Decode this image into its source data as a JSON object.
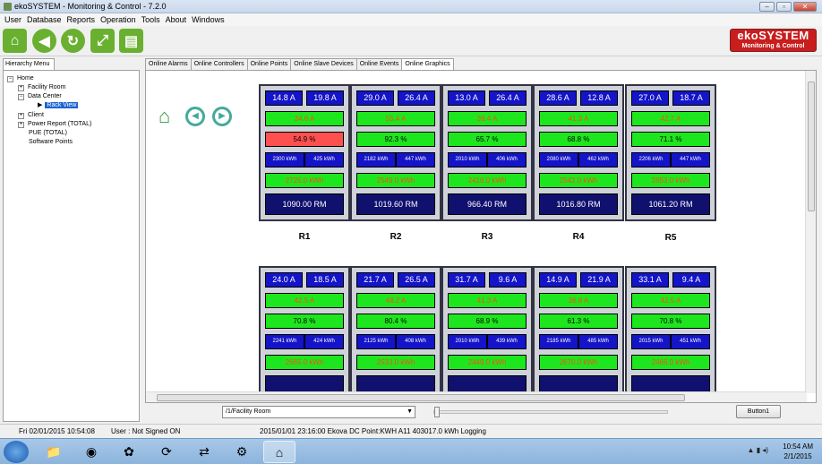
{
  "window": {
    "title": "ekoSYSTEM - Monitoring & Control - 7.2.0"
  },
  "menu": [
    "User",
    "Database",
    "Reports",
    "Operation",
    "Tools",
    "About",
    "Windows"
  ],
  "logo": {
    "line1": "ekoSYSTEM",
    "line2": "Monitoring & Control"
  },
  "left_panel": {
    "tab": "Hierarchy Menu",
    "tree": [
      {
        "label": "Home",
        "sign": "−"
      },
      {
        "label": "Facility Room",
        "sign": "+"
      },
      {
        "label": "Data Center",
        "sign": "−"
      },
      {
        "label": "Rack View",
        "sign": ""
      },
      {
        "label": "Client",
        "sign": "+"
      },
      {
        "label": "Power Report (TOTAL)",
        "sign": "+"
      },
      {
        "label": "PUE (TOTAL)",
        "sign": ""
      },
      {
        "label": "Software Points",
        "sign": ""
      }
    ]
  },
  "tabs": [
    "Online Alarms",
    "Online Controllers",
    "Online Points",
    "Online Slave Devices",
    "Online Events",
    "Online Graphics"
  ],
  "racks_top": [
    {
      "label": "R1",
      "a1": "14.8 A",
      "a2": "19.8 A",
      "load": "34.6 A",
      "pct": "54.9 %",
      "pct_alarm": true,
      "kwh1": "2300 kWh",
      "kwh2": "425 kWh",
      "total_kwh": "2725.0 kWh",
      "rm": "1090.00 RM"
    },
    {
      "label": "R2",
      "a1": "29.0 A",
      "a2": "26.4 A",
      "load": "55.4 A",
      "pct": "92.3 %",
      "pct_alarm": false,
      "kwh1": "2182 kWh",
      "kwh2": "447 kWh",
      "total_kwh": "2549.0 kWh",
      "rm": "1019.60 RM"
    },
    {
      "label": "R3",
      "a1": "13.0 A",
      "a2": "26.4 A",
      "load": "39.4 A",
      "pct": "65.7 %",
      "pct_alarm": false,
      "kwh1": "2010 kWh",
      "kwh2": "406 kWh",
      "total_kwh": "2416.0 kWh",
      "rm": "966.40 RM"
    },
    {
      "label": "R4",
      "a1": "28.6 A",
      "a2": "12.8 A",
      "load": "41.3 A",
      "pct": "68.8 %",
      "pct_alarm": false,
      "kwh1": "2080 kWh",
      "kwh2": "462 kWh",
      "total_kwh": "2542.0 kWh",
      "rm": "1016.80 RM"
    },
    {
      "label": "R5",
      "a1": "27.0 A",
      "a2": "18.7 A",
      "load": "42.7 A",
      "pct": "71.1 %",
      "pct_alarm": false,
      "kwh1": "2206 kWh",
      "kwh2": "447 kWh",
      "total_kwh": "2653.0 kWh",
      "rm": "1061.20 RM"
    }
  ],
  "racks_bottom": [
    {
      "a1": "24.0 A",
      "a2": "18.5 A",
      "load": "42.5 A",
      "pct": "70.8 %",
      "kwh1": "2241 kWh",
      "kwh2": "424 kWh",
      "total_kwh": "2665.0 kWh"
    },
    {
      "a1": "21.7 A",
      "a2": "26.5 A",
      "load": "48.2 A",
      "pct": "80.4 %",
      "kwh1": "2125 kWh",
      "kwh2": "408 kWh",
      "total_kwh": "2533.0 kWh"
    },
    {
      "a1": "31.7 A",
      "a2": "9.6 A",
      "load": "41.3 A",
      "pct": "68.9 %",
      "kwh1": "2010 kWh",
      "kwh2": "439 kWh",
      "total_kwh": "2449.0 kWh"
    },
    {
      "a1": "14.9 A",
      "a2": "21.9 A",
      "load": "36.8 A",
      "pct": "61.3 %",
      "kwh1": "2185 kWh",
      "kwh2": "485 kWh",
      "total_kwh": "2670.0 kWh"
    },
    {
      "a1": "33.1 A",
      "a2": "9.4 A",
      "load": "42.5 A",
      "pct": "70.8 %",
      "kwh1": "2015 kWh",
      "kwh2": "451 kWh",
      "total_kwh": "2466.0 kWh"
    }
  ],
  "bottom": {
    "path": "/1/Facility Room",
    "button": "Button1"
  },
  "status": {
    "datetime": "Fri 02/01/2015 10:54:08",
    "user": "User : Not Signed ON",
    "event": "2015/01/01 23:16:00 Ekova DC Point:KWH A11 403017.0 kWh Logging"
  },
  "taskbar": {
    "time": "10:54 AM",
    "date": "2/1/2015"
  },
  "colors": {
    "green": "#1ee61e",
    "blue": "#1414c8",
    "navy": "#10106e",
    "alarm": "#ff5050",
    "brand": "#c81e1e"
  }
}
